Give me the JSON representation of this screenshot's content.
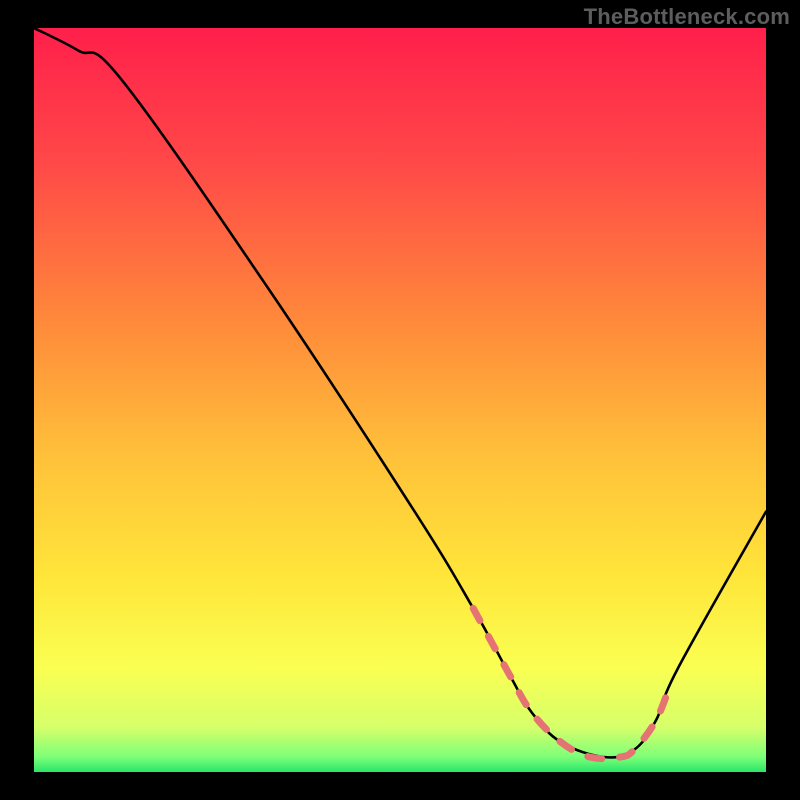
{
  "watermark": "TheBottleneck.com",
  "chart_data": {
    "type": "line",
    "title": "",
    "xlabel": "",
    "ylabel": "",
    "xlim": [
      0,
      100
    ],
    "ylim": [
      0,
      100
    ],
    "gradient_stops": [
      {
        "offset": 0,
        "color": "#ff1f4b"
      },
      {
        "offset": 18,
        "color": "#ff4848"
      },
      {
        "offset": 40,
        "color": "#ff8b3a"
      },
      {
        "offset": 58,
        "color": "#ffc23a"
      },
      {
        "offset": 74,
        "color": "#ffe63a"
      },
      {
        "offset": 86,
        "color": "#faff52"
      },
      {
        "offset": 94,
        "color": "#d6ff6a"
      },
      {
        "offset": 98,
        "color": "#7dff78"
      },
      {
        "offset": 100,
        "color": "#29e56a"
      }
    ],
    "series": [
      {
        "name": "bottleneck-curve",
        "x": [
          0,
          6,
          12,
          32,
          52,
          60,
          65,
          68,
          72,
          78,
          82,
          85,
          88,
          100
        ],
        "y": [
          100,
          97,
          93,
          65,
          35,
          22,
          13,
          8,
          4,
          2,
          3,
          7,
          14,
          35
        ]
      }
    ],
    "emphasis_dash": {
      "x": [
        60,
        65,
        68,
        72,
        76,
        80,
        82,
        85,
        87
      ],
      "y": [
        22,
        13,
        8,
        4,
        2,
        2,
        3,
        7,
        12
      ]
    }
  }
}
